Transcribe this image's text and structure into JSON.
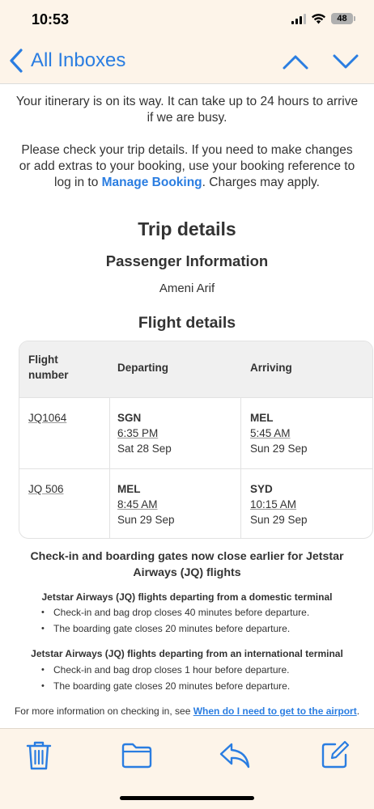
{
  "status_bar": {
    "time": "10:53",
    "battery": "48"
  },
  "nav": {
    "back_label": "All Inboxes"
  },
  "email": {
    "para1": "Your itinerary is on its way. It can take up to 24 hours to arrive if we are busy.",
    "para2_before": "Please check your trip details. If you need to make changes or add extras to your booking, use your booking reference to log in to ",
    "para2_link": "Manage Booking",
    "para2_after": ". Charges may apply.",
    "trip_heading": "Trip details",
    "passenger_heading": "Passenger Information",
    "passenger_name": "Ameni Arif",
    "flight_heading": "Flight details",
    "table": {
      "headers": {
        "flight_number_1": "Flight",
        "flight_number_2": "number",
        "departing": "Departing",
        "arriving": "Arriving"
      },
      "rows": [
        {
          "flight": "JQ1064",
          "dep_code": "SGN",
          "dep_time": "6:35 PM",
          "dep_date": "Sat 28 Sep",
          "arr_code": "MEL",
          "arr_time": "5:45 AM",
          "arr_date": "Sun 29 Sep"
        },
        {
          "flight": "JQ 506",
          "dep_code": "MEL",
          "dep_time": "8:45 AM",
          "dep_date": "Sun 29 Sep",
          "arr_code": "SYD",
          "arr_time": "10:15 AM",
          "arr_date": "Sun 29 Sep"
        }
      ]
    },
    "notice_heading": "Check-in and boarding gates now close earlier for Jetstar Airways (JQ) flights",
    "domestic_heading": "Jetstar Airways (JQ) flights departing from a domestic terminal",
    "domestic_items": [
      "Check-in and bag drop closes 40 minutes before departure.",
      "The boarding gate closes 20 minutes before departure."
    ],
    "international_heading": "Jetstar Airways (JQ) flights departing from an international terminal",
    "international_items": [
      "Check-in and bag drop closes 1 hour before departure.",
      "The boarding gate closes 20 minutes before departure."
    ],
    "more_info_text": "For more information on checking in, see ",
    "more_info_link": "When do I need to get to the airport",
    "more_info_end": "."
  },
  "toolbar": {
    "icons": [
      "trash-icon",
      "folder-icon",
      "reply-icon",
      "compose-icon"
    ]
  },
  "colors": {
    "accent": "#2a7de1",
    "bar_bg": "#fdf4e9",
    "text": "#333333"
  }
}
